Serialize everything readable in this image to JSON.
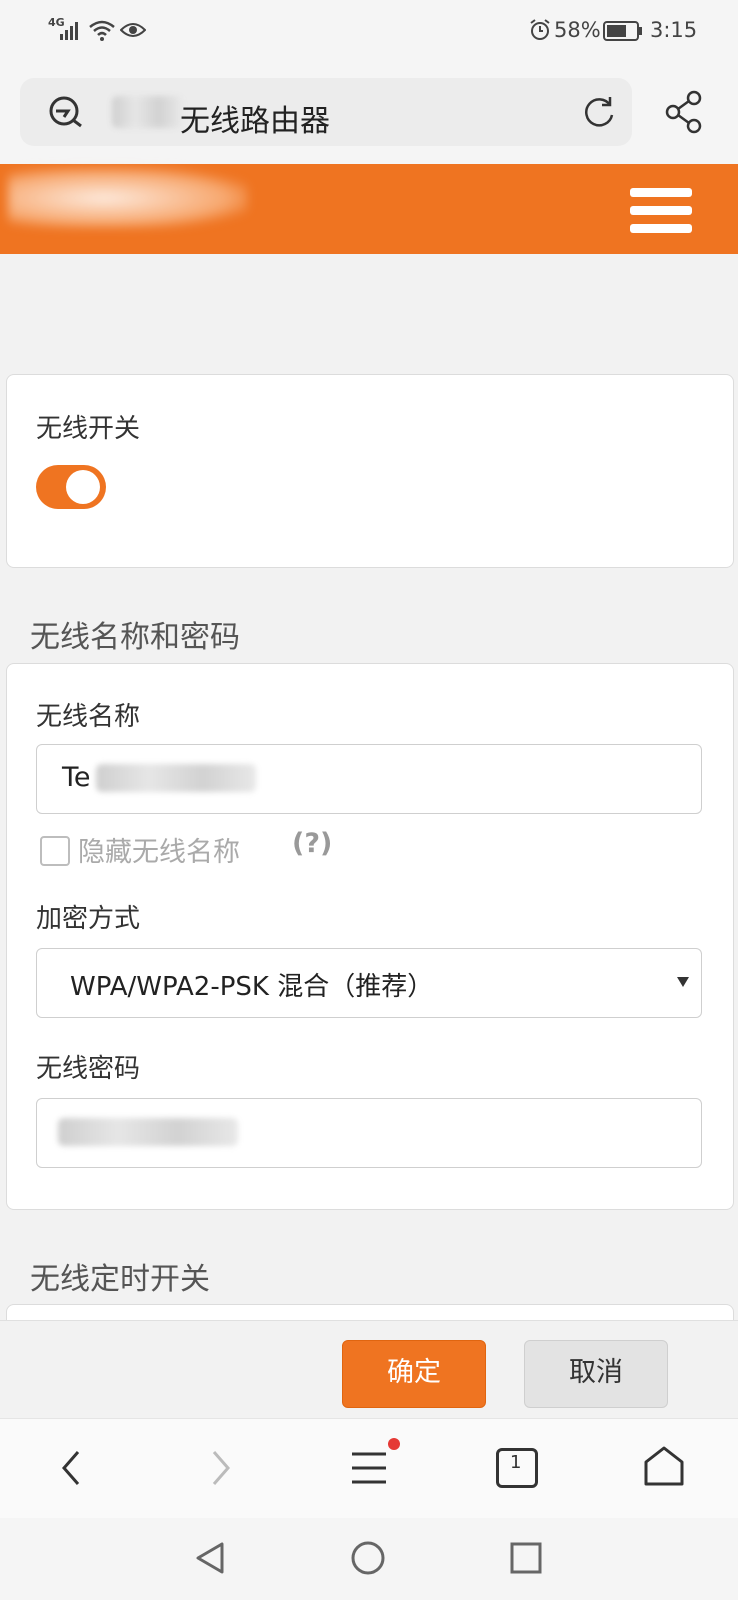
{
  "status_bar": {
    "network": "4G",
    "battery": "58%",
    "time": "3:15"
  },
  "browser": {
    "url_title": "无线路由器"
  },
  "wireless_switch": {
    "label": "无线开关",
    "enabled": true
  },
  "name_password_section": {
    "title": "无线名称和密码",
    "name_label": "无线名称",
    "name_value": "Te",
    "hide_name_label": "隐藏无线名称",
    "help_text": "(?)",
    "encryption_label": "加密方式",
    "encryption_value": "WPA/WPA2-PSK 混合（推荐）",
    "password_label": "无线密码"
  },
  "schedule_section": {
    "title": "无线定时开关"
  },
  "footer": {
    "confirm_label": "确定",
    "cancel_label": "取消"
  },
  "nav": {
    "tabs_count": "1"
  },
  "colors": {
    "accent": "#ef7421",
    "notification_dot": "#e53935"
  }
}
